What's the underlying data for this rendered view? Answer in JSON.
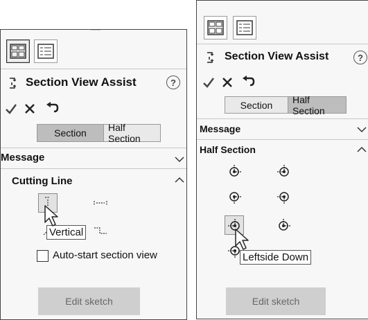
{
  "left_panel": {
    "title": "Section View Assist",
    "help": "?",
    "actions": {
      "ok_icon": "check-icon",
      "cancel_icon": "x-icon",
      "undo_icon": "undo-icon"
    },
    "segment": {
      "options": [
        "Section",
        "Half Section"
      ],
      "selected": "Section"
    },
    "message_label": "Message",
    "cutting_line_label": "Cutting Line",
    "tooltip": "Vertical",
    "checkbox_label": "Auto-start section view",
    "edit_button": "Edit sketch"
  },
  "right_panel": {
    "title": "Section View Assist",
    "help": "?",
    "actions": {
      "ok_icon": "check-icon",
      "cancel_icon": "x-icon",
      "undo_icon": "undo-icon"
    },
    "segment": {
      "options": [
        "Section",
        "Half Section"
      ],
      "selected": "Half Section"
    },
    "message_label": "Message",
    "half_section_label": "Half Section",
    "tooltip": "Leftside Down",
    "edit_button": "Edit sketch"
  },
  "colors": {
    "selected_segment": "#bdbdbd",
    "disabled_button": "#cfcfcf",
    "border": "#444444"
  }
}
